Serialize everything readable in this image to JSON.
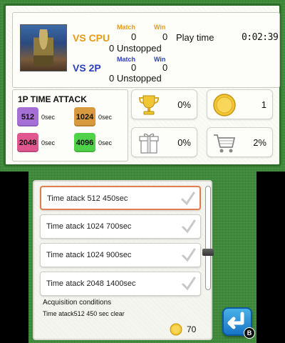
{
  "header": {
    "vs_cpu_label": "VS CPU",
    "vs_2p_label": "VS 2P",
    "match_label": "Match",
    "win_label": "Win",
    "cpu_match": "0",
    "cpu_win": "0",
    "cpu_unstopped": "0 Unstopped",
    "p2_match": "0",
    "p2_win": "0",
    "p2_unstopped": "0 Unstopped",
    "play_time_label": "Play time",
    "play_time_value": "0:02:39"
  },
  "time_attack": {
    "title": "1P TIME ATTACK",
    "tiles": [
      {
        "value": "512",
        "time": "0sec",
        "color": "#a56fd6"
      },
      {
        "value": "1024",
        "time": "0sec",
        "color": "#d89a3e"
      },
      {
        "value": "2048",
        "time": "0sec",
        "color": "#e0578f"
      },
      {
        "value": "4096",
        "time": "0sec",
        "color": "#4fd24a"
      }
    ]
  },
  "stats": {
    "trophy": {
      "value": "0%",
      "icon": "trophy-icon"
    },
    "coins": {
      "value": "1",
      "icon": "coin-icon"
    },
    "gift": {
      "value": "0%",
      "icon": "gift-icon"
    },
    "cart": {
      "value": "2%",
      "icon": "cart-icon"
    }
  },
  "list": {
    "items": [
      {
        "label": "Time atack 512 450sec",
        "selected": true
      },
      {
        "label": "Time atack 1024 700sec",
        "selected": false
      },
      {
        "label": "Time atack 1024 900sec",
        "selected": false
      },
      {
        "label": "Time atack 2048 1400sec",
        "selected": false
      }
    ]
  },
  "acquisition": {
    "title": "Acquisition conditions",
    "text": "Time atack512 450 sec clear",
    "cost": "70"
  },
  "back_button": {
    "badge": "B"
  },
  "colors": {
    "green_bg": "#3f8a3a",
    "vs_cpu": "#e89a14",
    "vs_2p": "#2a3fbe",
    "selected_border": "#e07e52",
    "back_button": "#1e88d6"
  }
}
